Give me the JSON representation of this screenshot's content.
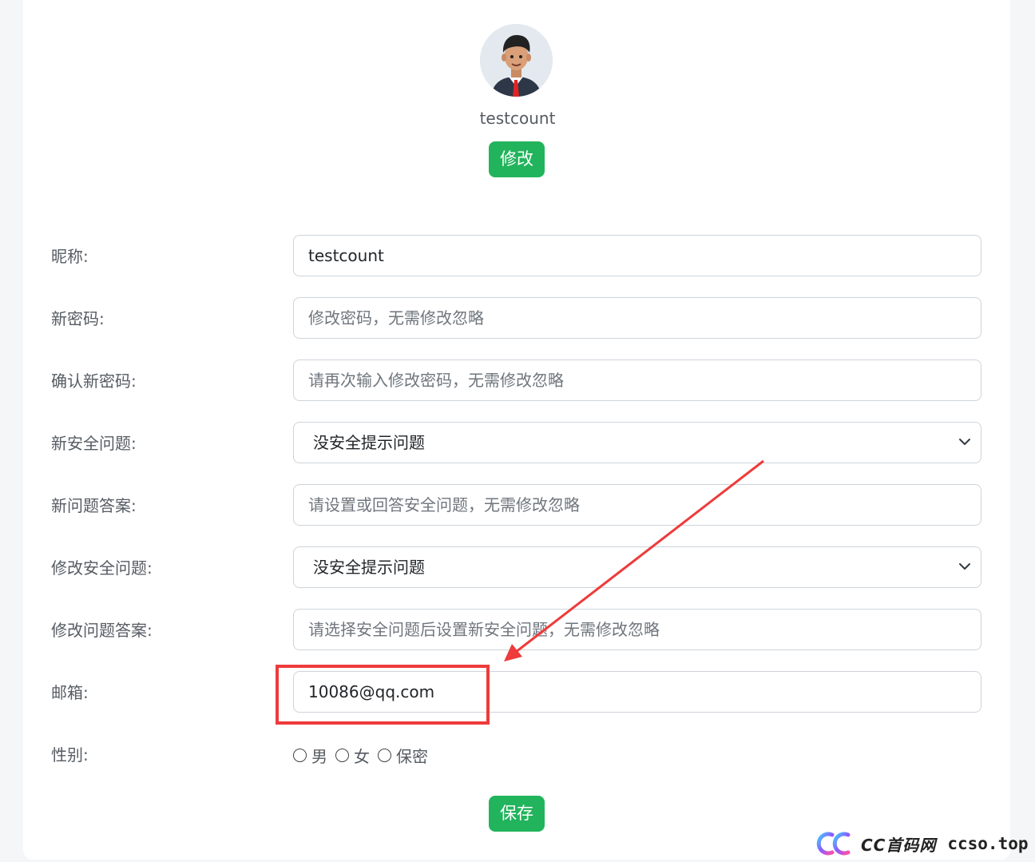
{
  "profile": {
    "username": "testcount",
    "edit_label": "修改"
  },
  "form": {
    "nickname_label": "昵称:",
    "nickname_value": "testcount",
    "new_password_label": "新密码:",
    "new_password_placeholder": "修改密码，无需修改忽略",
    "confirm_password_label": "确认新密码:",
    "confirm_password_placeholder": "请再次输入修改密码，无需修改忽略",
    "new_security_question_label": "新安全问题:",
    "new_security_question_value": "没安全提示问题",
    "new_answer_label": "新问题答案:",
    "new_answer_placeholder": "请设置或回答安全问题，无需修改忽略",
    "modify_security_question_label": "修改安全问题:",
    "modify_security_question_value": "没安全提示问题",
    "modify_answer_label": "修改问题答案:",
    "modify_answer_placeholder": "请选择安全问题后设置新安全问题，无需修改忽略",
    "email_label": "邮箱:",
    "email_value": "10086@qq.com",
    "gender_label": "性别:",
    "gender_options": [
      "男",
      "女",
      "保密"
    ],
    "save_label": "保存"
  },
  "watermark": {
    "brand": "CC首码网",
    "domain": "ccso.top"
  },
  "colors": {
    "accent": "#22b45c",
    "annotation": "#ee3b3b"
  }
}
